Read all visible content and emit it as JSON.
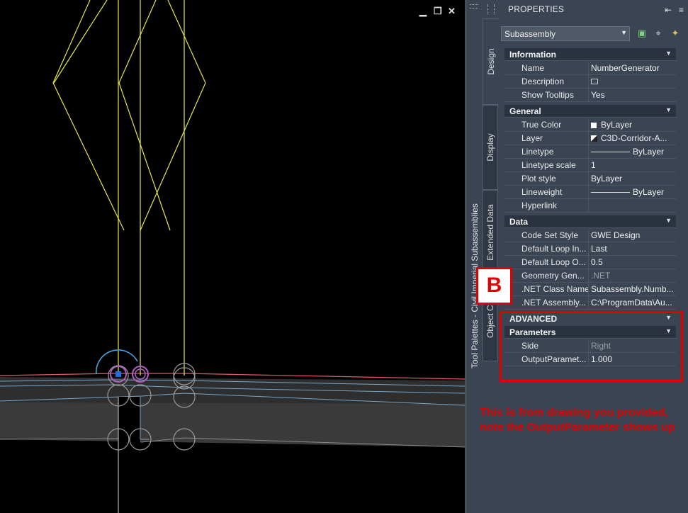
{
  "viewport": {
    "controls": {
      "minimize": "▁",
      "restore": "❐",
      "close": "✕"
    }
  },
  "tool_palette": {
    "title": "Tool Palettes - Civil Imperial Subassemblies"
  },
  "properties": {
    "title": "PROPERTIES",
    "object_type": "Subassembly",
    "side_tabs": [
      "Design",
      "Display",
      "Extended Data",
      "Object Cla"
    ],
    "sections": {
      "information": {
        "title": "Information",
        "rows": [
          {
            "key": "Name",
            "value": "NumberGenerator"
          },
          {
            "key": "Description",
            "value": ""
          },
          {
            "key": "Show Tooltips",
            "value": "Yes"
          }
        ]
      },
      "general": {
        "title": "General",
        "rows": [
          {
            "key": "True Color",
            "value": "ByLayer"
          },
          {
            "key": "Layer",
            "value": "C3D-Corridor-A..."
          },
          {
            "key": "Linetype",
            "value": "ByLayer"
          },
          {
            "key": "Linetype scale",
            "value": "1"
          },
          {
            "key": "Plot style",
            "value": "ByLayer"
          },
          {
            "key": "Lineweight",
            "value": "ByLayer"
          },
          {
            "key": "Hyperlink",
            "value": ""
          }
        ]
      },
      "data": {
        "title": "Data",
        "rows": [
          {
            "key": "Code Set Style",
            "value": "GWE Design"
          },
          {
            "key": "Default Loop In...",
            "value": "Last"
          },
          {
            "key": "Default Loop O...",
            "value": "0.5"
          },
          {
            "key": "Geometry Gen...",
            "value": ".NET"
          },
          {
            "key": ".NET Class Name",
            "value": "Subassembly.Numb..."
          },
          {
            "key": ".NET Assembly...",
            "value": "C:\\ProgramData\\Au..."
          }
        ]
      },
      "advanced": {
        "title": "ADVANCED"
      },
      "parameters": {
        "title": "Parameters",
        "rows": [
          {
            "key": "Side",
            "value": "Right"
          },
          {
            "key": "OutputParamet...",
            "value": "1.000"
          }
        ]
      }
    }
  },
  "callout": {
    "badge": "B",
    "note": "This is from drawing you provided, note the OutputParameter shows up"
  },
  "colors": {
    "panel_bg": "#3b4453",
    "annotation_red": "#e00000",
    "drawing_yellow": "#e8e84a"
  }
}
